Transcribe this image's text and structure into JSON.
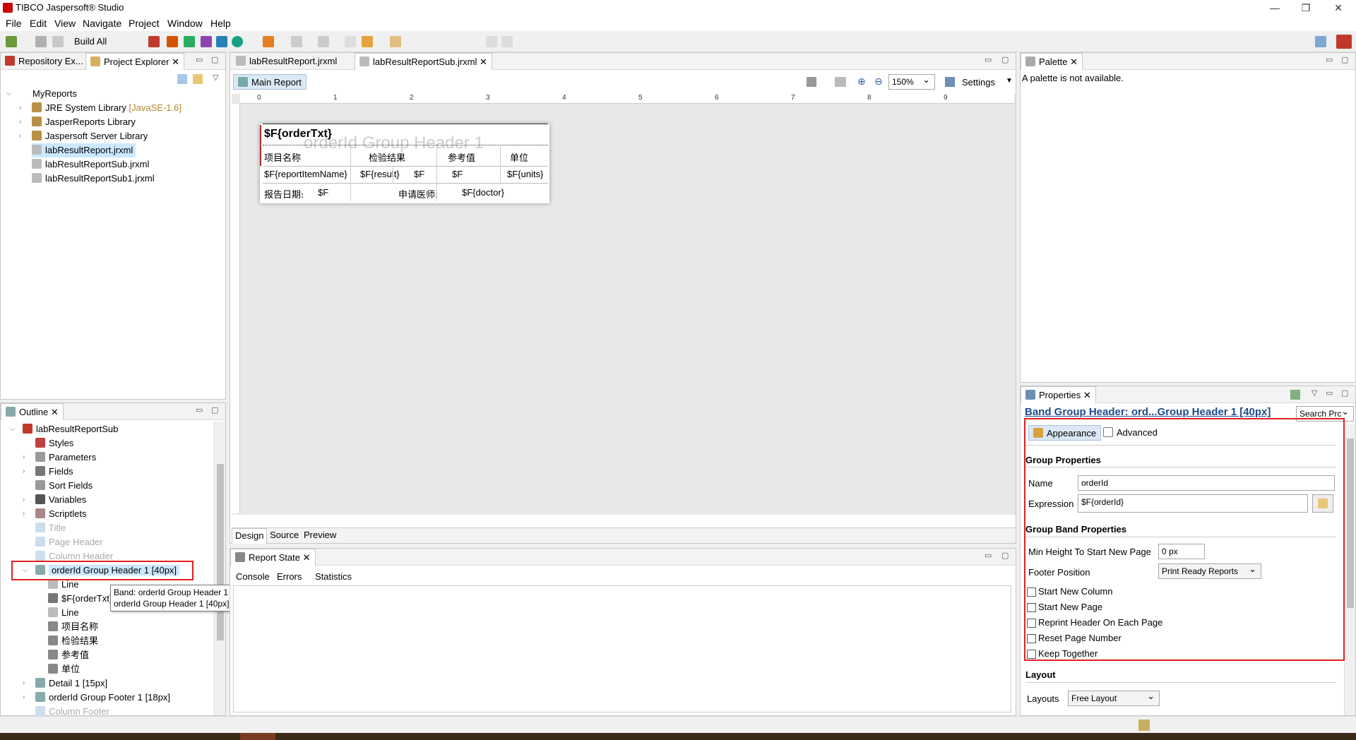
{
  "app": {
    "title": "TIBCO Jaspersoft® Studio"
  },
  "menu": [
    "File",
    "Edit",
    "View",
    "Navigate",
    "Project",
    "Window",
    "Help"
  ],
  "toolbar": {
    "build_all": "Build All"
  },
  "left_top": {
    "tabs": [
      "Repository Ex...",
      "Project Explorer"
    ],
    "tree": [
      {
        "label": "MyReports",
        "indent": 0
      },
      {
        "label": "JRE System Library",
        "suffix": "[JavaSE-1.6]",
        "indent": 1
      },
      {
        "label": "JasperReports Library",
        "indent": 1
      },
      {
        "label": "Jaspersoft Server Library",
        "indent": 1
      },
      {
        "label": "labResultReport.jrxml",
        "indent": 1
      },
      {
        "label": "labResultReportSub.jrxml",
        "indent": 1
      },
      {
        "label": "labResultReportSub1.jrxml",
        "indent": 1
      }
    ]
  },
  "outline": {
    "tab": "Outline",
    "items": [
      "labResultReportSub",
      "Styles",
      "Parameters",
      "Fields",
      "Sort Fields",
      "Variables",
      "Scriptlets",
      "Title",
      "Page Header",
      "Column Header",
      "orderId Group Header 1 [40px]",
      "Line",
      "$F{orderTxt}",
      "Line",
      "项目名称",
      "检验结果",
      "参考值",
      "单位",
      "Detail 1 [15px]",
      "orderId Group Footer 1 [18px]",
      "Column Footer"
    ],
    "tooltip": [
      "Band: orderId Group Header 1 [40px]",
      "orderId Group Header 1 [40px]"
    ]
  },
  "editor": {
    "tabs": [
      "labResultReport.jrxml",
      "labResultReportSub.jrxml"
    ],
    "breadcrumb": "Main Report",
    "zoom": "150%",
    "settings": "Settings",
    "ruler_labels": [
      "0",
      "1",
      "2",
      "3",
      "4",
      "5",
      "6",
      "7",
      "8",
      "9"
    ],
    "band_watermark": "orderId Group Header 1",
    "report": {
      "title_field": "$F{orderTxt}",
      "headers": [
        "项目名称",
        "检验结果",
        "参考值",
        "单位"
      ],
      "detail": [
        "$F{reportItemName}",
        "$F{result}",
        "$F",
        "$F",
        "$F{units}"
      ],
      "footer": [
        "报告日期:",
        "$F",
        "申请医师:",
        "$F{doctor}"
      ]
    },
    "bottom_tabs": [
      "Design",
      "Source",
      "Preview"
    ]
  },
  "report_state": {
    "tab": "Report State",
    "subtabs": [
      "Console",
      "Errors",
      "Statistics"
    ]
  },
  "palette": {
    "tab": "Palette",
    "message": "A palette is not available."
  },
  "properties": {
    "tab": "Properties",
    "header": "Band Group Header: ord...Group Header 1 [40px]",
    "search": "Search Prc",
    "tabs": [
      "Appearance",
      "Advanced"
    ],
    "group_properties": "Group Properties",
    "name_label": "Name",
    "name_value": "orderId",
    "expression_label": "Expression",
    "expression_value": "$F{orderId}",
    "group_band_properties": "Group Band Properties",
    "min_height_label": "Min Height To Start New Page",
    "min_height_value": "0 px",
    "footer_position_label": "Footer Position",
    "footer_position_value": "Print Ready Reports",
    "checkboxes": [
      "Start New Column",
      "Start New Page",
      "Reprint Header On Each Page",
      "Reset Page Number",
      "Keep Together"
    ],
    "layout_title": "Layout",
    "layouts_label": "Layouts",
    "layouts_value": "Free Layout"
  }
}
